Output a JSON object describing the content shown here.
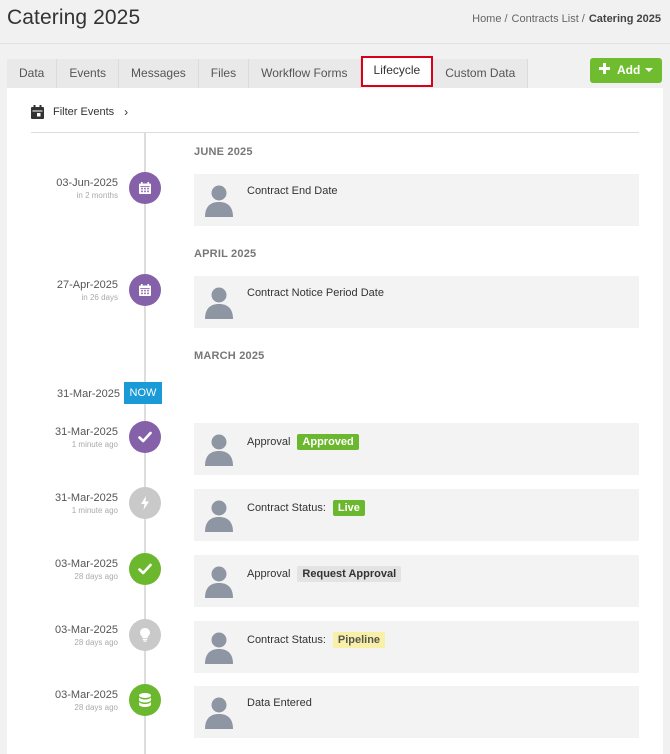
{
  "header": {
    "title": "Catering 2025",
    "breadcrumb": [
      "Home",
      "Contracts List",
      "Catering 2025"
    ],
    "separator": "/"
  },
  "tabs": [
    "Data",
    "Events",
    "Messages",
    "Files",
    "Workflow Forms",
    "Lifecycle",
    "Custom Data"
  ],
  "active_tab": "Lifecycle",
  "add_button": {
    "label": "Add"
  },
  "filter": {
    "label": "Filter Events",
    "chevron": "›"
  },
  "months": [
    "JUNE 2025",
    "APRIL 2025",
    "MARCH 2025"
  ],
  "now": {
    "date": "31-Mar-2025",
    "label": "NOW"
  },
  "events": [
    {
      "date": "03-Jun-2025",
      "relative": "in 2 months",
      "icon": "calendar-icon",
      "node_color": "#8561a9",
      "text": "Contract End Date",
      "badge": "",
      "badge_type": ""
    },
    {
      "date": "27-Apr-2025",
      "relative": "in 26 days",
      "icon": "calendar-icon",
      "node_color": "#8561a9",
      "text": "Contract Notice Period Date",
      "badge": "",
      "badge_type": ""
    },
    {
      "date": "31-Mar-2025",
      "relative": "1 minute ago",
      "icon": "check-icon",
      "node_color": "#8561a9",
      "text": "Approval",
      "badge": "Approved",
      "badge_type": "approved"
    },
    {
      "date": "31-Mar-2025",
      "relative": "1 minute ago",
      "icon": "bolt-icon",
      "node_color": "#c9c9c9",
      "text": "Contract Status:",
      "badge": "Live",
      "badge_type": "live"
    },
    {
      "date": "03-Mar-2025",
      "relative": "28 days ago",
      "icon": "check-icon",
      "node_color": "#6bb82e",
      "text": "Approval",
      "badge": "Request Approval",
      "badge_type": "request"
    },
    {
      "date": "03-Mar-2025",
      "relative": "28 days ago",
      "icon": "lightbulb-icon",
      "node_color": "#c9c9c9",
      "text": "Contract Status:",
      "badge": "Pipeline",
      "badge_type": "pipeline"
    },
    {
      "date": "03-Mar-2025",
      "relative": "28 days ago",
      "icon": "database-icon",
      "node_color": "#6bb82e",
      "text": "Data Entered",
      "badge": "",
      "badge_type": ""
    }
  ],
  "colors": {
    "purple": "#8561a9",
    "grey": "#c9c9c9",
    "green": "#6bb82e",
    "now_blue": "#1a9ad6",
    "active_tab_border": "#d9001b",
    "pipeline_badge": "#f7f0a6"
  }
}
